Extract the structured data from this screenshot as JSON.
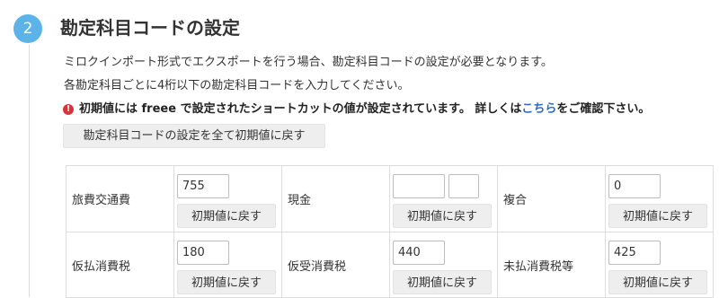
{
  "section": {
    "step_number": "2",
    "title": "勘定科目コードの設定",
    "description_1": "ミロクインポート形式でエクスポートを行う場合、勘定科目コードの設定が必要となります。",
    "description_2": "各勘定科目ごとに4桁以下の勘定科目コードを入力してください。",
    "notice_icon": "exclamation-circle-icon",
    "notice_prefix": "初期値には freee で設定されたショートカットの値が設定されています。 詳しくは",
    "notice_link": "こちら",
    "notice_suffix": "をご確認下さい。",
    "reset_all_label": "勘定科目コードの設定を全て初期値に戻す"
  },
  "colors": {
    "step_circle": "#5bb3e8",
    "link": "#2a6bc1",
    "warning": "#d8333a",
    "button_bg": "#eeeeee",
    "border": "#dddddd"
  },
  "reset_button_label": "初期値に戻す",
  "accounts": [
    {
      "name": "旅費交通費",
      "code": "755",
      "placeholder": ""
    },
    {
      "name": "現金",
      "code": "",
      "code_2": "",
      "placeholder": ""
    },
    {
      "name": "複合",
      "code": "0",
      "placeholder": ""
    },
    {
      "name": "仮払消費税",
      "code": "180",
      "placeholder": ""
    },
    {
      "name": "仮受消費税",
      "code": "440",
      "placeholder": ""
    },
    {
      "name": "未払消費税等",
      "code": "425",
      "placeholder": ""
    }
  ]
}
